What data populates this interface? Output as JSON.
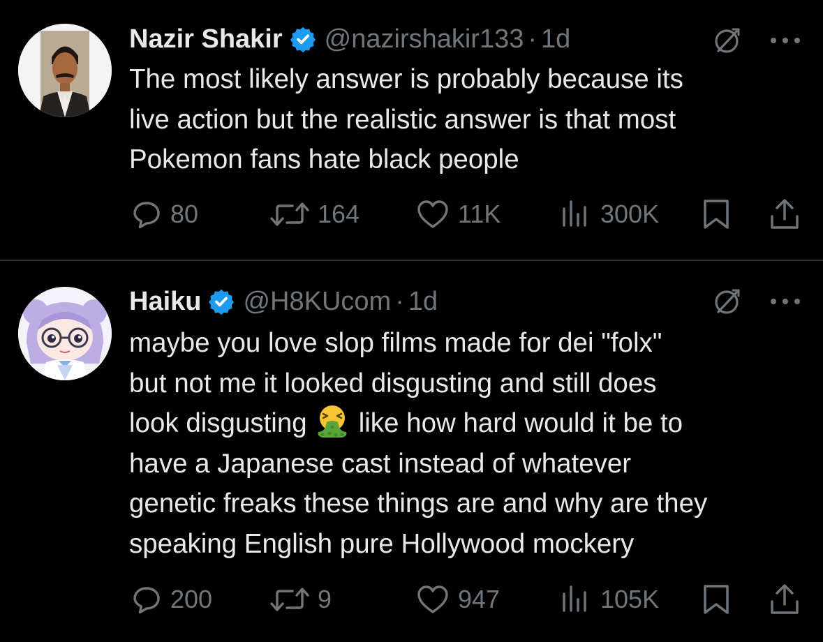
{
  "tweets": [
    {
      "display_name": "Nazir Shakir",
      "handle": "@nazirshakir133",
      "time": "1d",
      "verified": true,
      "text_lines": [
        "The most likely answer is probably because its",
        "live action but the realistic answer is that most",
        "Pokemon fans hate black people"
      ],
      "stats": {
        "replies": "80",
        "reposts": "164",
        "likes": "11K",
        "views": "300K"
      }
    },
    {
      "display_name": "Haiku",
      "handle": "@H8KUcom",
      "time": "1d",
      "verified": true,
      "text_lines": [
        "maybe you love slop films made for dei \"folx\"",
        "but not me it looked disgusting and still does",
        "look disgusting",
        "like how hard would it be to",
        "have a Japanese cast instead of whatever",
        "genetic freaks these things are and why are they",
        "speaking English pure Hollywood mockery"
      ],
      "stats": {
        "replies": "200",
        "reposts": "9",
        "likes": "947",
        "views": "105K"
      }
    }
  ],
  "separator": "·",
  "icons": {
    "verified": "verified-badge-icon",
    "grok": "grok-icon",
    "more": "more-icon",
    "reply": "reply-icon",
    "repost": "repost-icon",
    "like": "like-icon",
    "views": "views-icon",
    "bookmark": "bookmark-icon",
    "share": "share-icon",
    "emoji": "vomiting-face-emoji"
  },
  "colors": {
    "background": "#000000",
    "text": "#e7e9ea",
    "muted": "#71767b",
    "verified": "#1d9bf0",
    "divider": "#2f3336"
  }
}
